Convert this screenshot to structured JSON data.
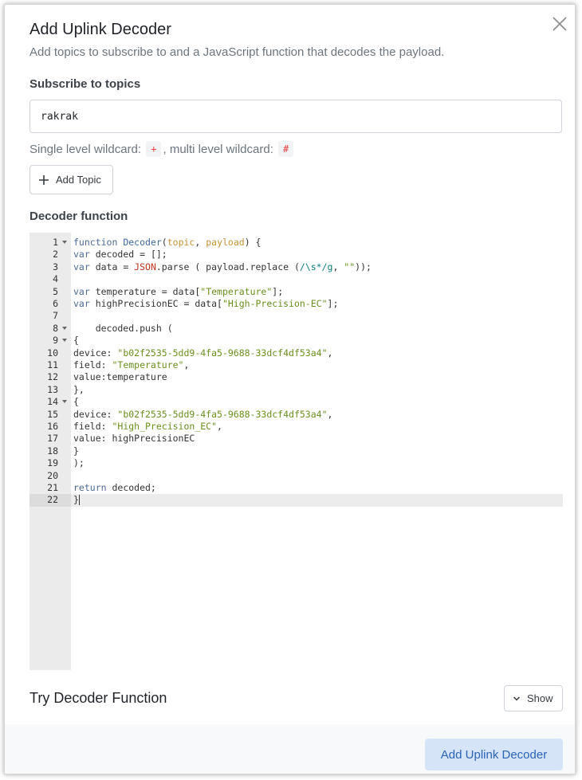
{
  "dialog": {
    "title": "Add Uplink Decoder",
    "subtitle": "Add topics to subscribe to and a JavaScript function that decodes the payload.",
    "close_icon": "close-icon"
  },
  "topics": {
    "label": "Subscribe to topics",
    "value": "rakrak",
    "wildcard_prefix": "Single level wildcard: ",
    "single_wildcard": "+",
    "wildcard_middle": ", multi level wildcard: ",
    "multi_wildcard": "#",
    "add_topic_label": "Add Topic",
    "add_icon": "plus-icon"
  },
  "decoder": {
    "label": "Decoder function",
    "active_line": 22,
    "foldable_lines": [
      1,
      8,
      9,
      14
    ],
    "lines": [
      "function Decoder(topic, payload) {",
      "var decoded = [];",
      "var data = JSON.parse ( payload.replace (/\\s*/g, \"\"));",
      "",
      "var temperature = data[\"Temperature\"];",
      "var highPrecisionEC = data[\"High-Precision-EC\"];",
      "",
      "    decoded.push (",
      "{",
      "device: \"b02f2535-5dd9-4fa5-9688-33dcf4df53a4\",",
      "field: \"Temperature\",",
      "value:temperature",
      "},",
      "{",
      "device: \"b02f2535-5dd9-4fa5-9688-33dcf4df53a4\",",
      "field: \"High_Precision_EC\",",
      "value: highPrecisionEC",
      "}",
      ");",
      "",
      "return decoded;",
      "}"
    ]
  },
  "try_decoder": {
    "title": "Try Decoder Function",
    "show_label": "Show",
    "chevron_icon": "chevron-down-icon"
  },
  "footer": {
    "submit_label": "Add Uplink Decoder"
  },
  "colors": {
    "primary_text": "#2b63b5",
    "primary_bg": "#d6e4f7",
    "wildcard_code": "#e83e3e"
  }
}
